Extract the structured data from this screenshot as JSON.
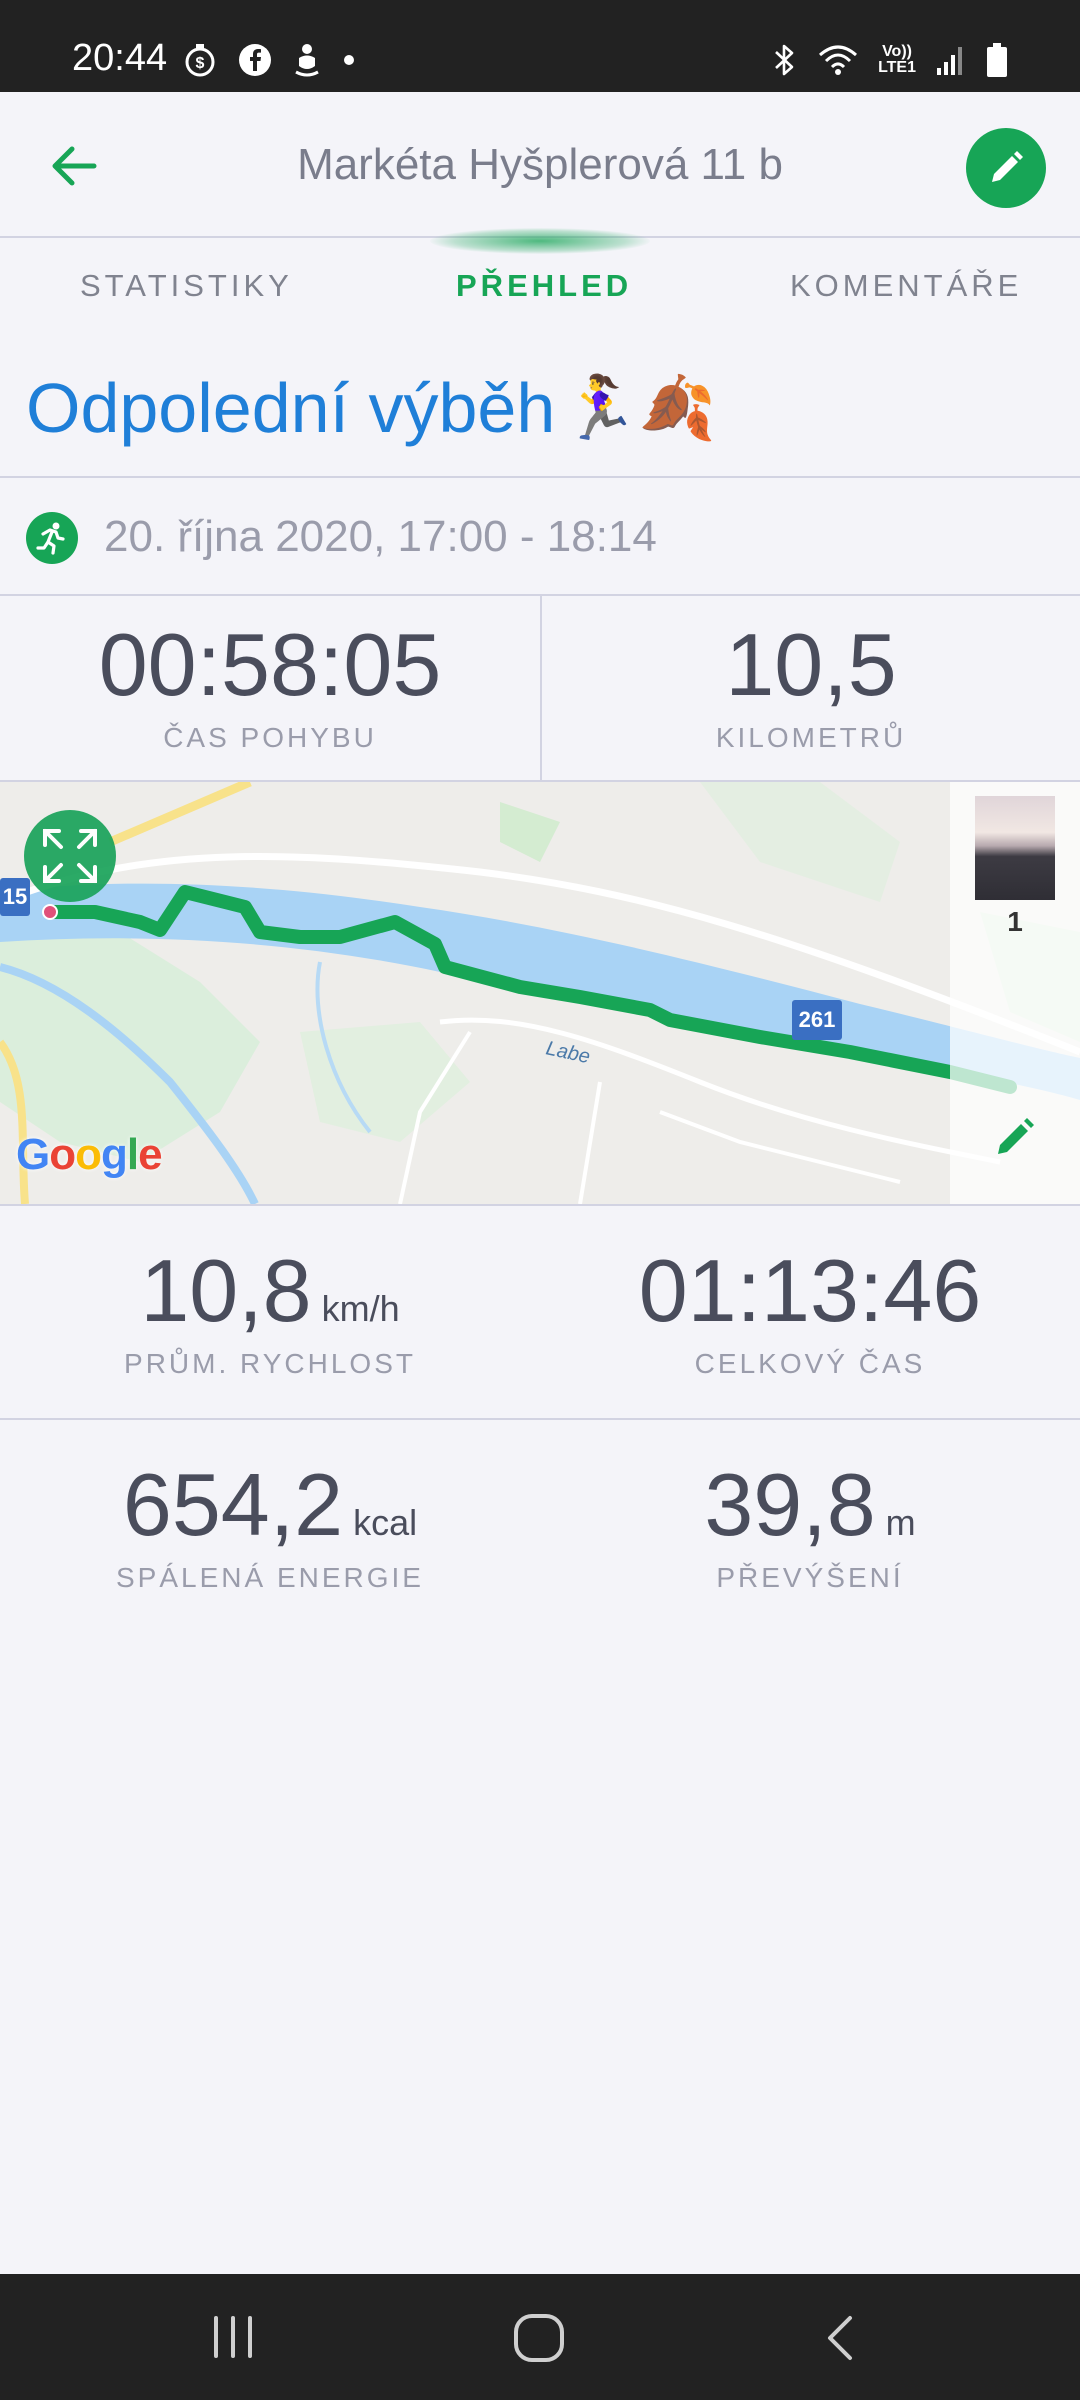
{
  "status_bar": {
    "time": "20:44",
    "left_icons": [
      "stopwatch-dollar-icon",
      "facebook-icon",
      "fitness-app-icon",
      "dot-icon"
    ],
    "right_icons": [
      "bluetooth-icon",
      "wifi-icon",
      "volte-icon",
      "signal-icon",
      "battery-icon"
    ],
    "volte_line1": "Vo))",
    "volte_line2": "LTE1"
  },
  "app_bar": {
    "title": "Markéta Hyšplerová  11 b"
  },
  "tabs": [
    {
      "label": "STATISTIKY",
      "active": false
    },
    {
      "label": "PŘEHLED",
      "active": true
    },
    {
      "label": "KOMENTÁŘE",
      "active": false
    }
  ],
  "activity": {
    "title": "Odpolední výběh",
    "emoji": "🏃‍♀️🍂",
    "date": "20. října 2020, 17:00 - 18:14"
  },
  "stats": {
    "moving_time": {
      "value": "00:58:05",
      "label": "ČAS POHYBU"
    },
    "distance": {
      "value": "10,5",
      "label": "KILOMETRŮ"
    },
    "avg_speed": {
      "value": "10,8",
      "unit": "km/h",
      "label": "PRŮM. RYCHLOST"
    },
    "total_time": {
      "value": "01:13:46",
      "label": "CELKOVÝ ČAS"
    },
    "energy": {
      "value": "654,2",
      "unit": "kcal",
      "label": "SPÁLENÁ ENERGIE"
    },
    "elevation": {
      "value": "39,8",
      "unit": "m",
      "label": "PŘEVÝŠENÍ"
    }
  },
  "map": {
    "river_label": "Labe",
    "road_badge_left": "15",
    "road_badge_right": "261",
    "google_logo": "Google",
    "photo_count": "1",
    "route_color": "#17a556",
    "river_color": "#a9d3f5"
  },
  "colors": {
    "accent": "#17a556",
    "title_blue": "#1f7fd8",
    "background": "#f4f4f9",
    "bars": "#222222"
  }
}
